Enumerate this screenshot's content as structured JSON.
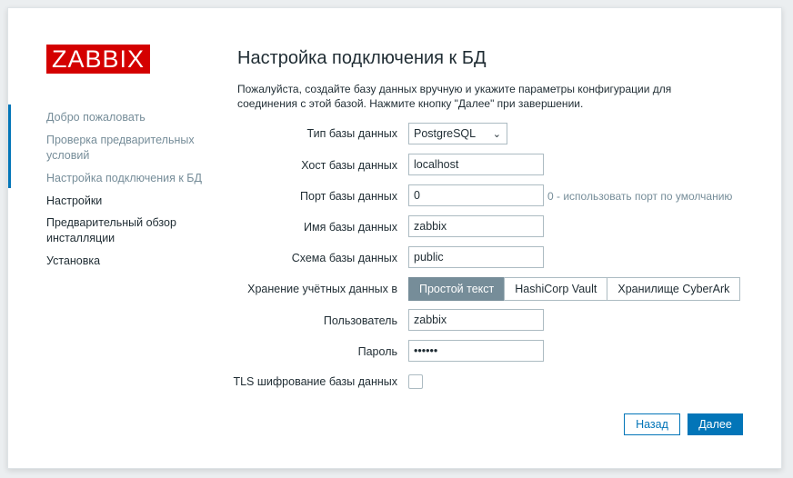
{
  "logo": "ZABBIX",
  "steps": [
    {
      "label": "Добро пожаловать",
      "state": "done"
    },
    {
      "label": "Проверка предварительных условий",
      "state": "done"
    },
    {
      "label": "Настройка подключения к БД",
      "state": "current"
    },
    {
      "label": "Настройки",
      "state": "pending"
    },
    {
      "label": "Предварительный обзор инсталляции",
      "state": "pending"
    },
    {
      "label": "Установка",
      "state": "pending"
    }
  ],
  "title": "Настройка подключения к БД",
  "description": "Пожалуйста, создайте базу данных вручную и укажите параметры конфигурации для соединения с этой базой. Нажмите кнопку \"Далее\" при завершении.",
  "form": {
    "db_type_label": "Тип базы данных",
    "db_type_value": "PostgreSQL",
    "host_label": "Хост базы данных",
    "host_value": "localhost",
    "port_label": "Порт базы данных",
    "port_value": "0",
    "port_hint": "0 - использовать порт по умолчанию",
    "name_label": "Имя базы данных",
    "name_value": "zabbix",
    "schema_label": "Схема базы данных",
    "schema_value": "public",
    "store_label": "Хранение учётных данных в",
    "store_options": [
      "Простой текст",
      "HashiCorp Vault",
      "Хранилище CyberArk"
    ],
    "store_selected": "Простой текст",
    "user_label": "Пользователь",
    "user_value": "zabbix",
    "password_label": "Пароль",
    "password_value": "••••••",
    "tls_label": "TLS шифрование базы данных",
    "tls_checked": false
  },
  "buttons": {
    "back": "Назад",
    "next": "Далее"
  },
  "colors": {
    "brand": "#d40000",
    "accent": "#0275b8",
    "muted": "#768d99"
  }
}
